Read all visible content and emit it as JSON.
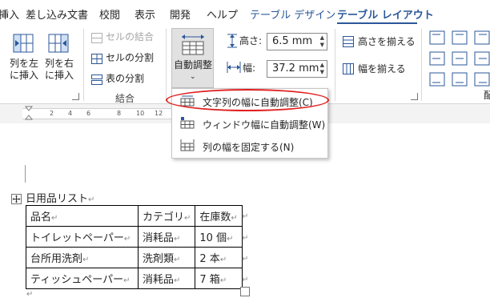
{
  "tabs": [
    {
      "label": "挿入"
    },
    {
      "label": "差し込み文書"
    },
    {
      "label": "校閲"
    },
    {
      "label": "表示"
    },
    {
      "label": "開発"
    },
    {
      "label": "ヘルプ"
    },
    {
      "label": "テーブル デザイン"
    },
    {
      "label": "テーブル レイアウト"
    }
  ],
  "ribbon": {
    "insert_left": "列を左\nに挿入",
    "insert_left_1": "列を左",
    "insert_left_2": "に挿入",
    "insert_right_1": "列を右",
    "insert_right_2": "に挿入",
    "merge_cells": "セルの結合",
    "split_cells": "セルの分割",
    "split_table": "表の分割",
    "merge_group": "結合",
    "autofit": "自動調整",
    "height_label": "高さ:",
    "height_value": "6.5 mm",
    "width_label": "幅:",
    "width_value": "37.2 mm",
    "distribute_rows": "高さを揃える",
    "distribute_cols": "幅を揃える",
    "edge_label": "配"
  },
  "ruler": {
    "ticks": [
      "2",
      "4",
      "6",
      "8",
      "10",
      "12"
    ]
  },
  "menu": {
    "items": [
      {
        "label": "文字列の幅に自動調整(C)"
      },
      {
        "label": "ウィンドウ幅に自動調整(W)"
      },
      {
        "label": "列の幅を固定する(N)"
      }
    ]
  },
  "document": {
    "title": "日用品リスト",
    "table": {
      "header": [
        "品名",
        "カテゴリ",
        "在庫数"
      ],
      "rows": [
        [
          "トイレットペーパー",
          "消耗品",
          "10 個"
        ],
        [
          "台所用洗剤",
          "洗剤類",
          "2 本"
        ],
        [
          "ティッシュペーパー",
          "消耗品",
          "7 箱"
        ]
      ]
    }
  },
  "colors": {
    "accent": "#2b579a",
    "highlight_oval": "#e02020"
  }
}
